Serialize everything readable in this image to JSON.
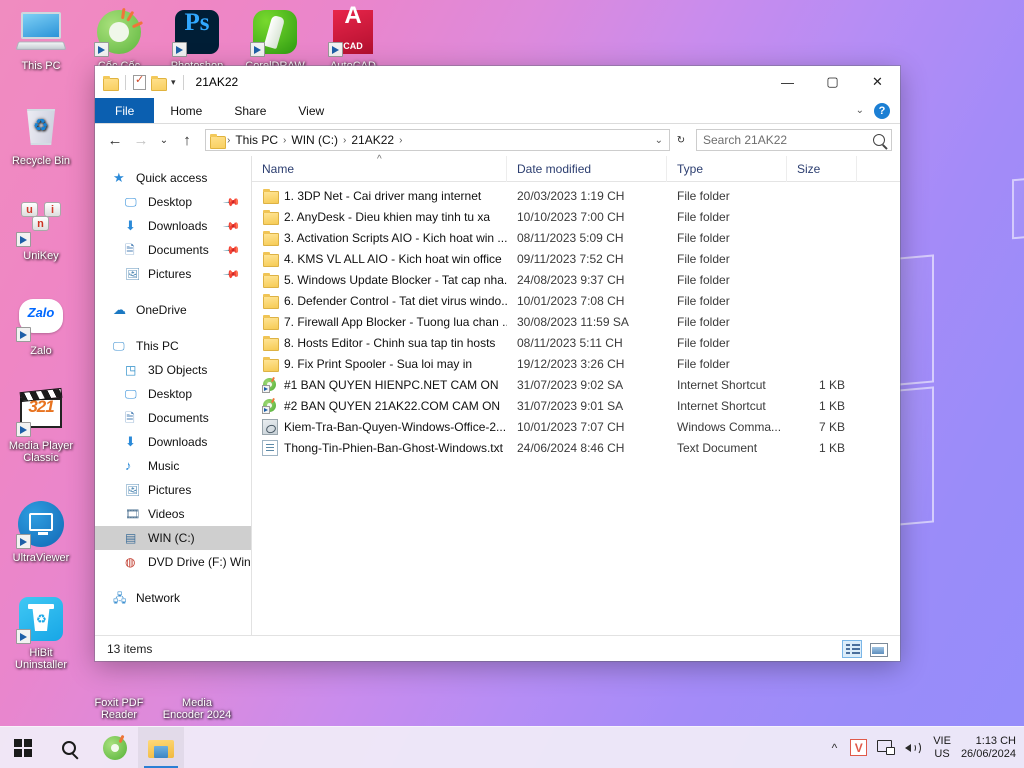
{
  "desktop": {
    "icons_col1": [
      {
        "label": "This PC",
        "icon": "this-pc-icon"
      },
      {
        "label": "Recycle Bin",
        "icon": "recycle-bin-icon"
      },
      {
        "label": "UniKey",
        "icon": "unikey-icon"
      },
      {
        "label": "Zalo",
        "icon": "zalo-icon"
      },
      {
        "label": "Media Player Classic",
        "icon": "media-player-classic-icon"
      },
      {
        "label": "UltraViewer",
        "icon": "ultraviewer-icon"
      },
      {
        "label": "HiBit Uninstaller",
        "icon": "hibit-uninstaller-icon"
      }
    ],
    "icons_row_top": [
      {
        "label": "Cốc Cốc",
        "icon": "coccoc-icon"
      },
      {
        "label": "Photoshop",
        "icon": "photoshop-icon"
      },
      {
        "label": "CorelDRAW",
        "icon": "coreldraw-icon"
      },
      {
        "label": "AutoCAD",
        "icon": "autocad-icon"
      }
    ],
    "icons_bottom_partial": [
      {
        "label_line1": "Foxit PDF",
        "label_line2": "Reader"
      },
      {
        "label_line1": "Media",
        "label_line2": "Encoder 2024"
      }
    ]
  },
  "window": {
    "title": "21AK22",
    "quick_access": {
      "folder_icon": "folder-icon",
      "properties_icon": "properties-icon",
      "new_folder_icon": "new-folder-icon",
      "customize_caret": "▾"
    },
    "controls": {
      "minimize": "—",
      "maximize": "▢",
      "close": "✕"
    },
    "ribbon_tabs": [
      {
        "label": "File",
        "active": true
      },
      {
        "label": "Home",
        "active": false
      },
      {
        "label": "Share",
        "active": false
      },
      {
        "label": "View",
        "active": false
      }
    ],
    "ribbon_right": {
      "expand_caret": "⌄",
      "help_label": "?"
    },
    "nav": {
      "back": "←",
      "forward": "→",
      "recent": "⌄",
      "up": "↑",
      "breadcrumb": [
        "This PC",
        "WIN (C:)",
        "21AK22"
      ],
      "breadcrumb_sep": "›",
      "dropdown_caret": "⌄",
      "refresh": "↻"
    },
    "search": {
      "placeholder": "Search 21AK22",
      "value": "",
      "icon": "search-icon"
    },
    "navpane": [
      {
        "label": "Quick access",
        "icon": "star-icon",
        "level": 0,
        "pinned": false,
        "selected": false
      },
      {
        "label": "Desktop",
        "icon": "desktop-icon",
        "level": 1,
        "pinned": true,
        "selected": false
      },
      {
        "label": "Downloads",
        "icon": "downloads-icon",
        "level": 1,
        "pinned": true,
        "selected": false
      },
      {
        "label": "Documents",
        "icon": "documents-icon",
        "level": 1,
        "pinned": true,
        "selected": false
      },
      {
        "label": "Pictures",
        "icon": "pictures-icon",
        "level": 1,
        "pinned": true,
        "selected": false
      },
      {
        "gap": true
      },
      {
        "label": "OneDrive",
        "icon": "onedrive-icon",
        "level": 0,
        "pinned": false,
        "selected": false
      },
      {
        "gap": true
      },
      {
        "label": "This PC",
        "icon": "this-pc-icon",
        "level": 0,
        "pinned": false,
        "selected": false
      },
      {
        "label": "3D Objects",
        "icon": "3d-objects-icon",
        "level": 1,
        "pinned": false,
        "selected": false
      },
      {
        "label": "Desktop",
        "icon": "desktop-icon",
        "level": 1,
        "pinned": false,
        "selected": false
      },
      {
        "label": "Documents",
        "icon": "documents-icon",
        "level": 1,
        "pinned": false,
        "selected": false
      },
      {
        "label": "Downloads",
        "icon": "downloads-icon",
        "level": 1,
        "pinned": false,
        "selected": false
      },
      {
        "label": "Music",
        "icon": "music-icon",
        "level": 1,
        "pinned": false,
        "selected": false
      },
      {
        "label": "Pictures",
        "icon": "pictures-icon",
        "level": 1,
        "pinned": false,
        "selected": false
      },
      {
        "label": "Videos",
        "icon": "videos-icon",
        "level": 1,
        "pinned": false,
        "selected": false
      },
      {
        "label": "WIN (C:)",
        "icon": "hard-drive-icon",
        "level": 1,
        "pinned": false,
        "selected": true
      },
      {
        "label": "DVD Drive (F:) Win-",
        "icon": "dvd-drive-icon",
        "level": 1,
        "pinned": false,
        "selected": false
      },
      {
        "gap": true
      },
      {
        "label": "Network",
        "icon": "network-icon",
        "level": 0,
        "pinned": false,
        "selected": false
      }
    ],
    "columns": [
      {
        "label": "Name",
        "key": "name"
      },
      {
        "label": "Date modified",
        "key": "date"
      },
      {
        "label": "Type",
        "key": "type"
      },
      {
        "label": "Size",
        "key": "size"
      }
    ],
    "sort_indicator": "^",
    "files": [
      {
        "name": "1. 3DP Net - Cai driver mang internet",
        "date": "20/03/2023 1:19 CH",
        "type": "File folder",
        "size": "",
        "icon": "folder-icon"
      },
      {
        "name": "2. AnyDesk - Dieu khien may tinh tu xa",
        "date": "10/10/2023 7:00 CH",
        "type": "File folder",
        "size": "",
        "icon": "folder-icon"
      },
      {
        "name": "3. Activation Scripts AIO - Kich hoat win ...",
        "date": "08/11/2023 5:09 CH",
        "type": "File folder",
        "size": "",
        "icon": "folder-icon"
      },
      {
        "name": "4. KMS VL ALL AIO - Kich hoat win office",
        "date": "09/11/2023 7:52 CH",
        "type": "File folder",
        "size": "",
        "icon": "folder-icon"
      },
      {
        "name": "5. Windows Update Blocker - Tat cap nha...",
        "date": "24/08/2023 9:37 CH",
        "type": "File folder",
        "size": "",
        "icon": "folder-icon"
      },
      {
        "name": "6. Defender Control - Tat diet virus windo...",
        "date": "10/01/2023 7:08 CH",
        "type": "File folder",
        "size": "",
        "icon": "folder-icon"
      },
      {
        "name": "7. Firewall App Blocker - Tuong lua chan ...",
        "date": "30/08/2023 11:59 SA",
        "type": "File folder",
        "size": "",
        "icon": "folder-icon"
      },
      {
        "name": "8. Hosts Editor - Chinh sua tap tin hosts",
        "date": "08/11/2023 5:11 CH",
        "type": "File folder",
        "size": "",
        "icon": "folder-icon"
      },
      {
        "name": "9. Fix Print Spooler - Sua loi may in",
        "date": "19/12/2023 3:26 CH",
        "type": "File folder",
        "size": "",
        "icon": "folder-icon"
      },
      {
        "name": "#1 BAN QUYEN HIENPC.NET CAM ON",
        "date": "31/07/2023 9:02 SA",
        "type": "Internet Shortcut",
        "size": "1 KB",
        "icon": "internet-shortcut-icon"
      },
      {
        "name": "#2 BAN QUYEN 21AK22.COM CAM ON",
        "date": "31/07/2023 9:01 SA",
        "type": "Internet Shortcut",
        "size": "1 KB",
        "icon": "internet-shortcut-icon"
      },
      {
        "name": "Kiem-Tra-Ban-Quyen-Windows-Office-2...",
        "date": "10/01/2023 7:07 CH",
        "type": "Windows Comma...",
        "size": "7 KB",
        "icon": "windows-command-script-icon"
      },
      {
        "name": "Thong-Tin-Phien-Ban-Ghost-Windows.txt",
        "date": "24/06/2024 8:46 CH",
        "type": "Text Document",
        "size": "1 KB",
        "icon": "text-document-icon"
      }
    ],
    "status": {
      "item_count": "13 items",
      "view_details": "details-view-icon",
      "view_large": "large-icons-view-icon"
    }
  },
  "taskbar": {
    "start": "start-button",
    "search": "search-taskbar-icon",
    "apps": [
      {
        "name": "coccoc-taskbar-icon",
        "open": false
      },
      {
        "name": "file-explorer-taskbar-icon",
        "open": true
      }
    ],
    "tray": {
      "show_hidden": "^",
      "unikey": "V",
      "network": "network-tray-icon",
      "volume": "volume-tray-icon",
      "lang_line1": "VIE",
      "lang_line2": "US",
      "time": "1:13 CH",
      "date": "26/06/2024"
    }
  },
  "colors": {
    "accent": "#0b5fb0",
    "selection": "#cfcfcf",
    "folder": "#f6cb55",
    "taskbar": "#f0ecf8"
  }
}
